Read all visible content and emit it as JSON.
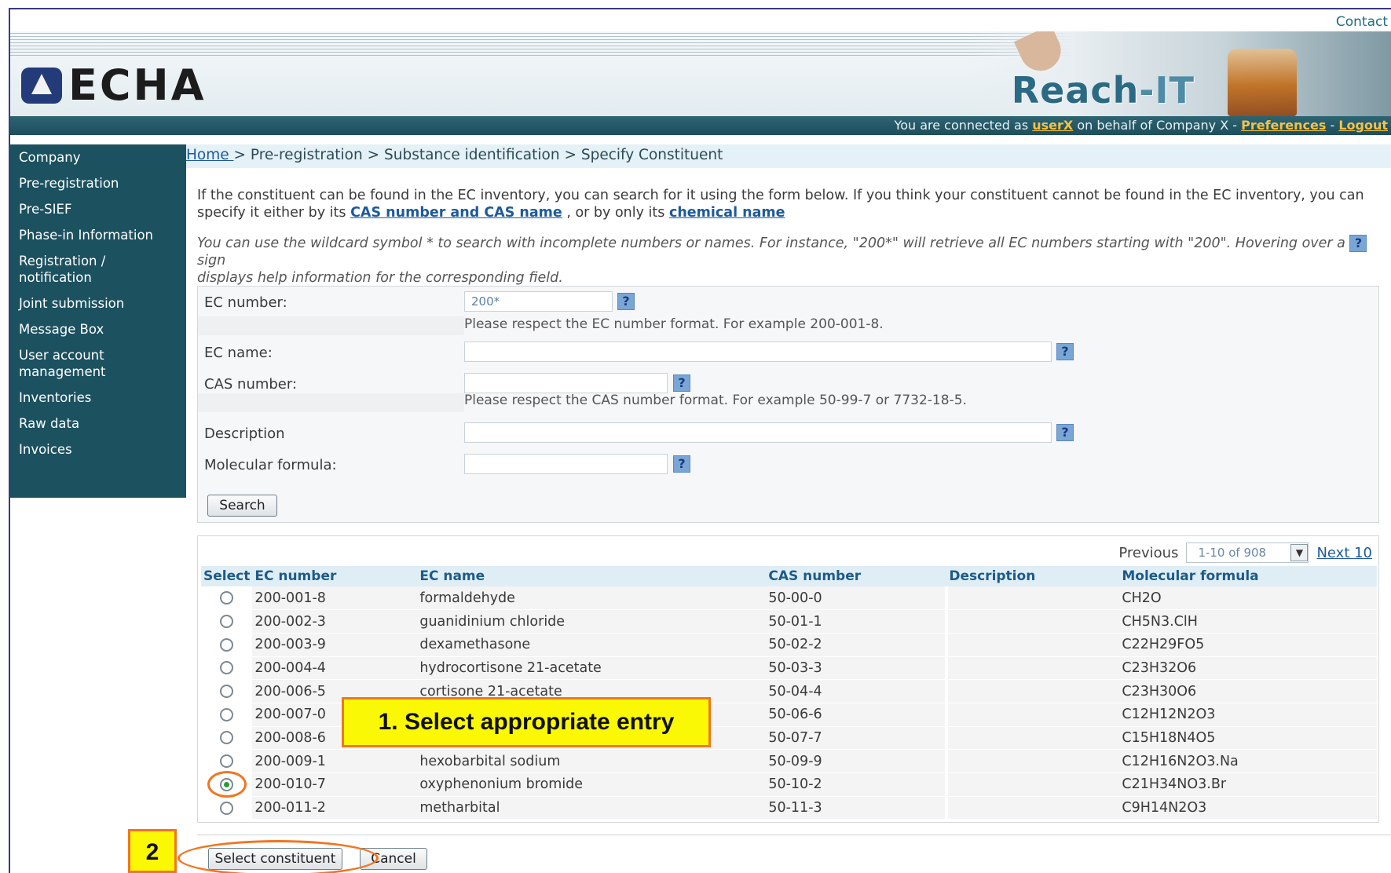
{
  "header": {
    "contact": "Contact",
    "logo_text": "ECHA",
    "app_title_a": "Reach",
    "app_title_b": "-IT",
    "connection": {
      "prefix": "You are connected as ",
      "user": "userX",
      "middle": " on behalf of Company X - ",
      "preferences": "Preferences",
      "sep": " - ",
      "logout": "Logout"
    }
  },
  "sidebar": {
    "items": [
      {
        "label": "Company"
      },
      {
        "label": "Pre-registration"
      },
      {
        "label": "Pre-SIEF"
      },
      {
        "label": "Phase-in Information"
      },
      {
        "label": "Registration /"
      },
      {
        "label": "notification"
      },
      {
        "label": "Joint submission"
      },
      {
        "label": "Message Box"
      },
      {
        "label": "User account"
      },
      {
        "label": "management"
      },
      {
        "label": "Inventories"
      },
      {
        "label": "Raw data"
      },
      {
        "label": "Invoices"
      }
    ]
  },
  "breadcrumb": {
    "home": "Home ",
    "rest": "> Pre-registration > Substance identification > Specify Constituent"
  },
  "intro": {
    "line1": "If the constituent can be found in the EC inventory, you can search for it using the form below. If you think your constituent cannot be found in the EC inventory, you can",
    "line2_a": "specify it either by its ",
    "cas_link": "CAS number and CAS name",
    "line2_b": " , or by only its ",
    "chem_link": "chemical name",
    "hint1_a": "You can use the wildcard symbol * to search with incomplete numbers or names. For instance, \"200*\" will retrieve all EC numbers starting with \"200\". Hovering over a ",
    "hint1_b": " sign",
    "hint2": "displays help information for the corresponding field."
  },
  "help_mark": "?",
  "form": {
    "ec_number_label": "EC number:",
    "ec_number_value": "200*",
    "ec_number_note": "Please respect the EC number format. For example 200-001-8.",
    "ec_name_label": "EC name:",
    "ec_name_value": "",
    "cas_number_label": "CAS number:",
    "cas_number_value": "",
    "cas_number_note": "Please respect the CAS number format. For example 50-99-7 or 7732-18-5.",
    "description_label": "Description",
    "description_value": "",
    "formula_label": "Molecular formula:",
    "formula_value": "",
    "search_button": "Search"
  },
  "pager": {
    "previous": "Previous",
    "range": "1-10 of 908",
    "next": "Next 10"
  },
  "table": {
    "columns": [
      "Select",
      "EC number",
      "EC name",
      "CAS number",
      "Description",
      "Molecular formula"
    ],
    "rows": [
      {
        "ec": "200-001-8",
        "name": "formaldehyde",
        "cas": "50-00-0",
        "desc": "",
        "formula": "CH2O",
        "selected": false
      },
      {
        "ec": "200-002-3",
        "name": "guanidinium chloride",
        "cas": "50-01-1",
        "desc": "",
        "formula": "CH5N3.ClH",
        "selected": false
      },
      {
        "ec": "200-003-9",
        "name": "dexamethasone",
        "cas": "50-02-2",
        "desc": "",
        "formula": "C22H29FO5",
        "selected": false
      },
      {
        "ec": "200-004-4",
        "name": "hydrocortisone 21-acetate",
        "cas": "50-03-3",
        "desc": "",
        "formula": "C23H32O6",
        "selected": false
      },
      {
        "ec": "200-006-5",
        "name": "cortisone 21-acetate",
        "cas": "50-04-4",
        "desc": "",
        "formula": "C23H30O6",
        "selected": false
      },
      {
        "ec": "200-007-0",
        "name": "",
        "cas": "50-06-6",
        "desc": "",
        "formula": "C12H12N2O3",
        "selected": false
      },
      {
        "ec": "200-008-6",
        "name": "",
        "cas": "50-07-7",
        "desc": "",
        "formula": "C15H18N4O5",
        "selected": false
      },
      {
        "ec": "200-009-1",
        "name": "hexobarbital sodium",
        "cas": "50-09-9",
        "desc": "",
        "formula": "C12H16N2O3.Na",
        "selected": false
      },
      {
        "ec": "200-010-7",
        "name": "oxyphenonium bromide",
        "cas": "50-10-2",
        "desc": "",
        "formula": "C21H34NO3.Br",
        "selected": true
      },
      {
        "ec": "200-011-2",
        "name": "metharbital",
        "cas": "50-11-3",
        "desc": "",
        "formula": "C9H14N2O3",
        "selected": false
      }
    ]
  },
  "actions": {
    "select_constituent": "Select constituent",
    "cancel": "Cancel"
  },
  "annotations": {
    "callout_1": "1. Select appropriate entry",
    "callout_2": "2"
  },
  "colors": {
    "sidebar_bg": "#1c5160",
    "accent_orange": "#f27521",
    "callout_yellow": "#fbf805",
    "link_blue": "#1d5a9b"
  }
}
